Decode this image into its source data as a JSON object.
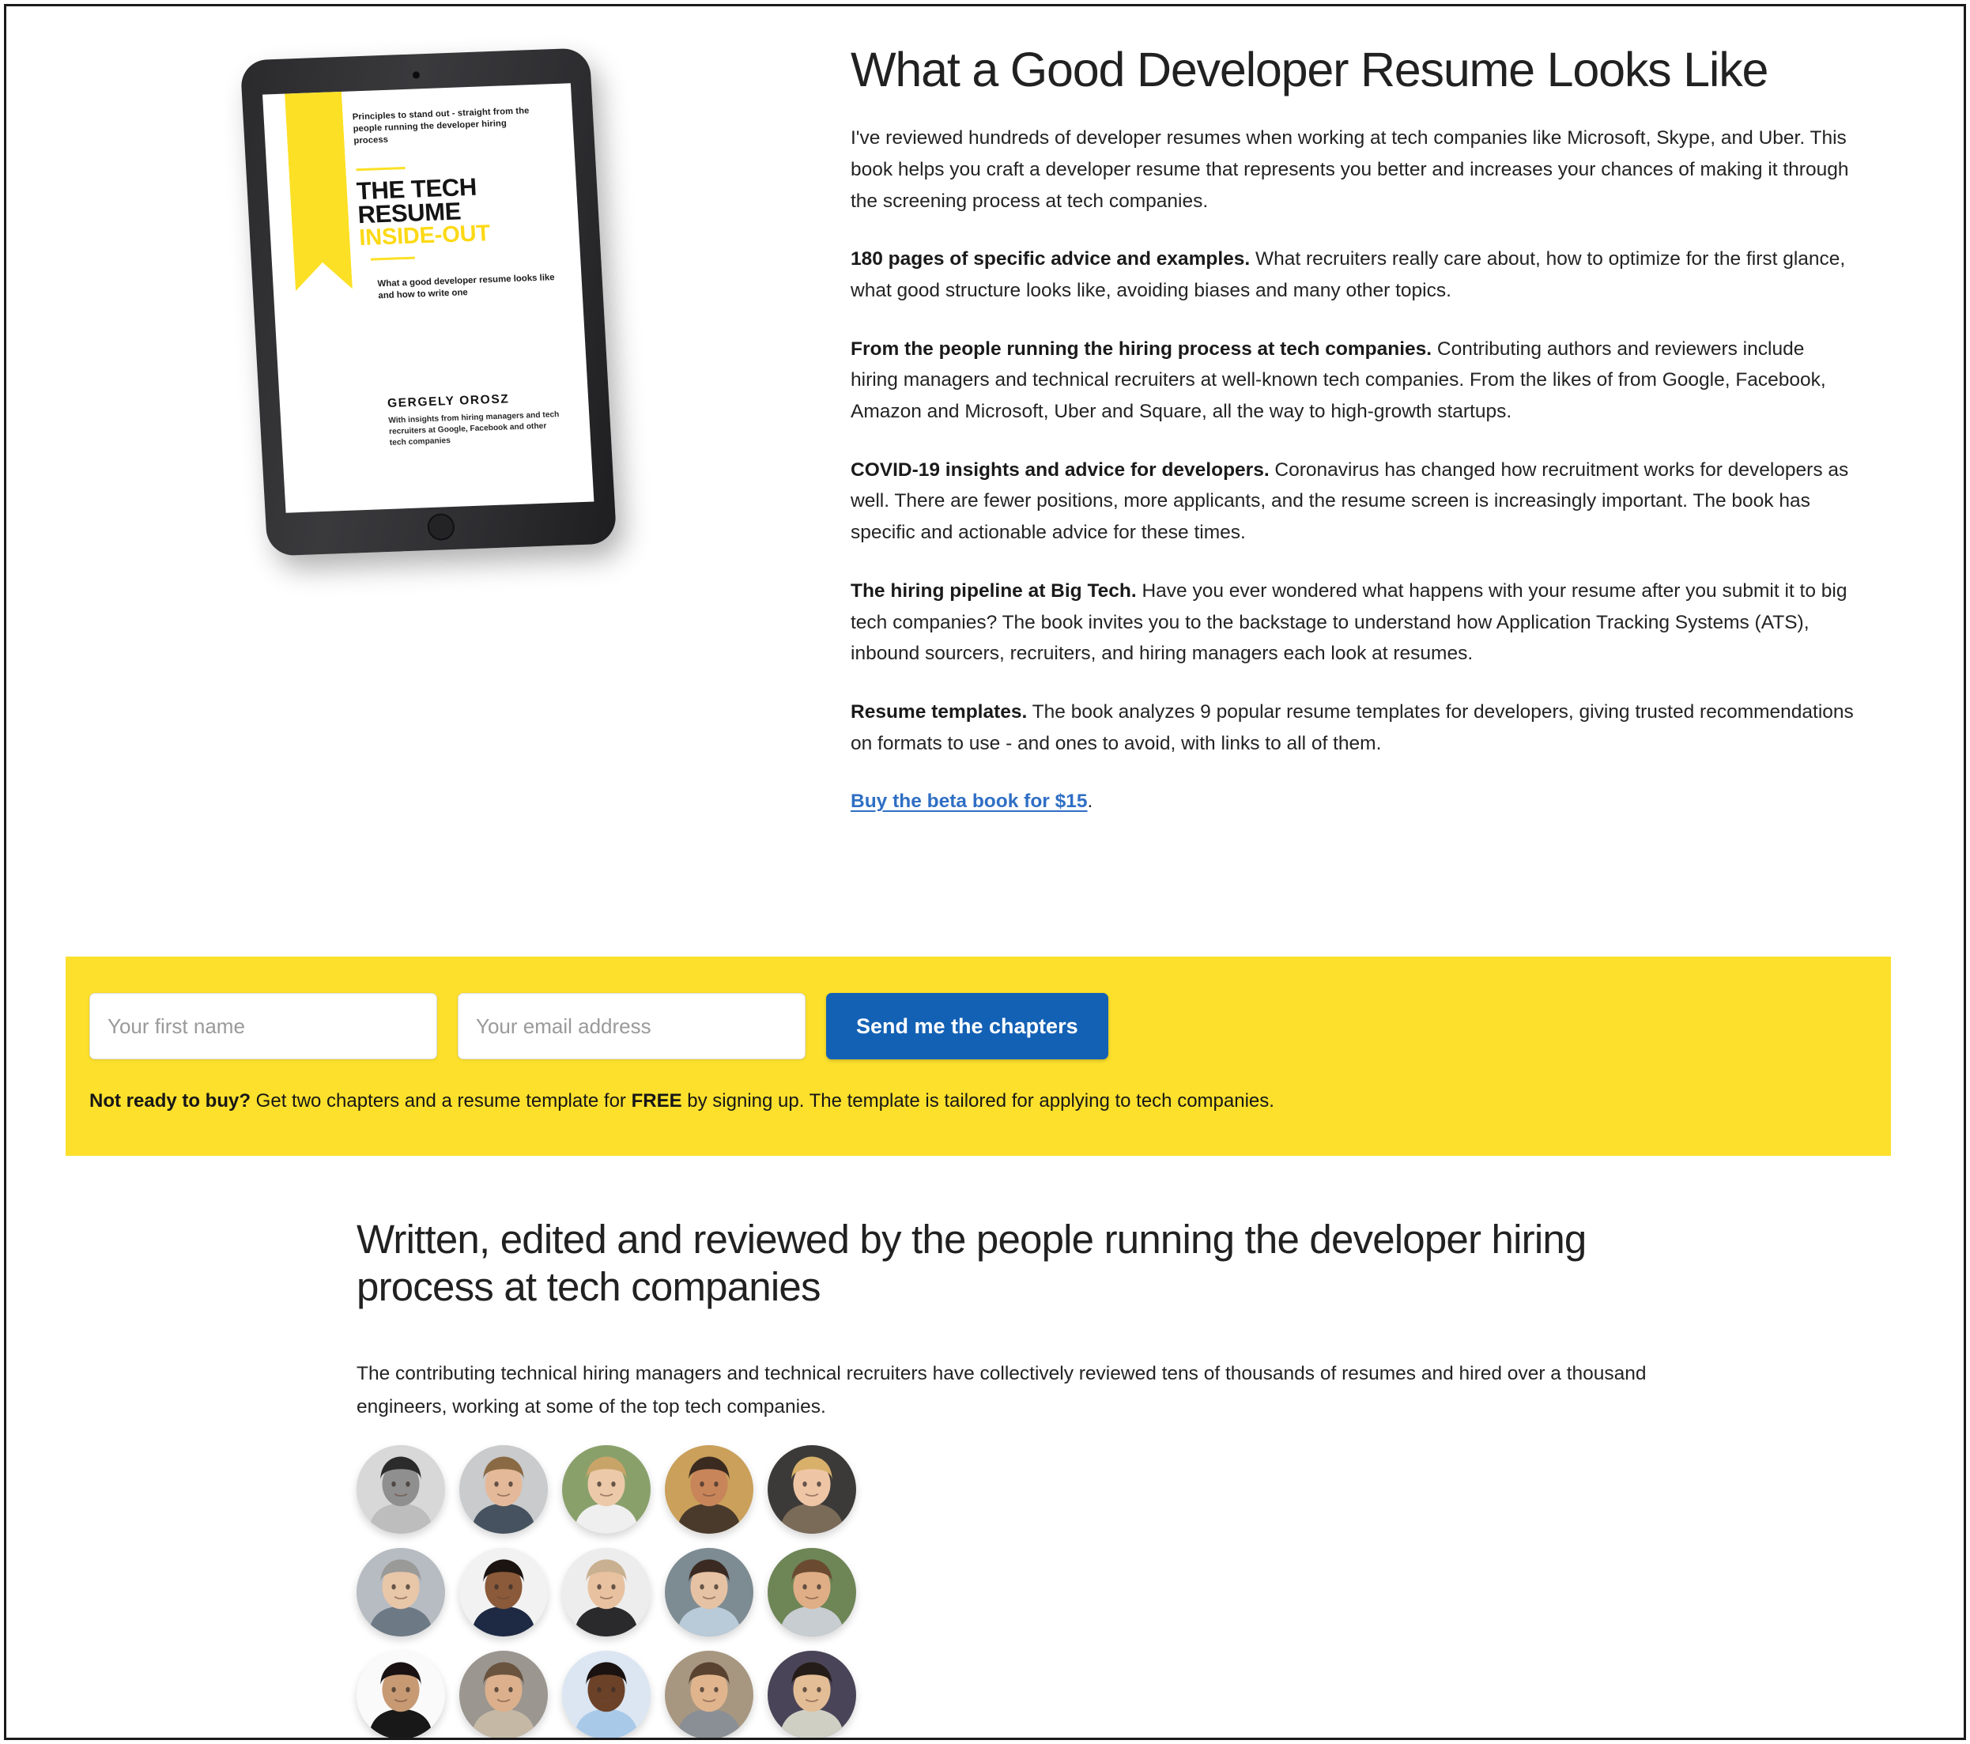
{
  "colors": {
    "accent_yellow": "#FCE02C",
    "button_blue": "#1361B5",
    "link_blue": "#2f6fc4",
    "text": "#232323"
  },
  "hero": {
    "title": "What a Good Developer Resume Looks Like",
    "paragraphs": [
      {
        "lead": "",
        "text": "I've reviewed hundreds of developer resumes when working at tech companies like Microsoft, Skype, and Uber. This book helps you craft a developer resume that represents you better and increases your chances of making it through the screening process at tech companies."
      },
      {
        "lead": "180 pages of specific advice and examples.",
        "text": " What recruiters really care about, how to optimize for the first glance, what good structure looks like, avoiding biases and many other topics."
      },
      {
        "lead": "From the people running the hiring process at tech companies.",
        "text": " Contributing authors and reviewers include hiring managers and technical recruiters at well-known tech companies. From the likes of from Google, Facebook, Amazon and Microsoft, Uber and Square, all the way to high-growth startups."
      },
      {
        "lead": "COVID-19 insights and advice for developers.",
        "text": " Coronavirus has changed how recruitment works for developers as well. There are fewer positions, more applicants, and the resume screen is increasingly important. The book has specific and actionable advice for these times."
      },
      {
        "lead": "The hiring pipeline at Big Tech.",
        "text": " Have you ever wondered what happens with your resume after you submit it to big tech companies? The book invites you to the backstage to understand how Application Tracking Systems (ATS), inbound sourcers, recruiters, and hiring managers each look at resumes."
      },
      {
        "lead": "Resume templates.",
        "text": " The book analyzes 9 popular resume templates for developers, giving trusted recommendations on formats to use - and ones to avoid, with links to all of them."
      }
    ],
    "buy_link_text": "Buy the beta book for $15",
    "buy_link_suffix": "."
  },
  "book_cover": {
    "kicker": "Principles to stand out - straight from the people running the developer hiring process",
    "title_line1": "THE TECH",
    "title_line2": "RESUME",
    "title_line3": "INSIDE-OUT",
    "subtitle": "What a good developer resume looks like and how to write one",
    "author": "GERGELY OROSZ",
    "credit": "With insights from hiring managers and tech recruiters at Google, Facebook and other tech companies"
  },
  "signup": {
    "first_name_placeholder": "Your first name",
    "first_name_value": "",
    "email_placeholder": "Your email address",
    "email_value": "",
    "submit_label": "Send me the chapters",
    "note_lead": "Not ready to buy?",
    "note_part1": " Get two chapters and a resume template for ",
    "note_free": "FREE",
    "note_part2": " by signing up. The template is tailored for applying to tech companies."
  },
  "contributors": {
    "title": "Written, edited and reviewed by the people running the developer hiring process at tech companies",
    "body": "The contributing technical hiring managers and technical recruiters have collectively reviewed tens of thousands of resumes and hired over a thousand engineers, working at some of the top tech companies.",
    "avatar_count": 15,
    "avatars": [
      {
        "name": "contributor-1",
        "bg": "#d8d8d8",
        "skin": "#8f8f8f",
        "hair": "#2b2b2b",
        "shirt": "#bdbdbd"
      },
      {
        "name": "contributor-2",
        "bg": "#c9cbcd",
        "skin": "#e4b99a",
        "hair": "#8a6a44",
        "shirt": "#46525f"
      },
      {
        "name": "contributor-3",
        "bg": "#8aa06a",
        "skin": "#eccaa9",
        "hair": "#c9a469",
        "shirt": "#efefef"
      },
      {
        "name": "contributor-4",
        "bg": "#caa05a",
        "skin": "#c8855a",
        "hair": "#3a2a20",
        "shirt": "#4a3a2c"
      },
      {
        "name": "contributor-5",
        "bg": "#3c3a38",
        "skin": "#eec6a6",
        "hair": "#d8b06a",
        "shirt": "#7a6a58"
      },
      {
        "name": "contributor-6",
        "bg": "#b7bcc2",
        "skin": "#e8c6a8",
        "hair": "#9a9a98",
        "shirt": "#6d7a86"
      },
      {
        "name": "contributor-7",
        "bg": "#f2f2f2",
        "skin": "#8a5a3a",
        "hair": "#1c1410",
        "shirt": "#1e2a44"
      },
      {
        "name": "contributor-8",
        "bg": "#ededed",
        "skin": "#e8c2a0",
        "hair": "#c9b091",
        "shirt": "#2a2a2c"
      },
      {
        "name": "contributor-9",
        "bg": "#7d8b92",
        "skin": "#e6c2a4",
        "hair": "#3a2a22",
        "shirt": "#b9cad8"
      },
      {
        "name": "contributor-10",
        "bg": "#6e8556",
        "skin": "#dfae86",
        "hair": "#6a4a30",
        "shirt": "#c8cdd2"
      },
      {
        "name": "contributor-11",
        "bg": "#fafafa",
        "skin": "#c79a74",
        "hair": "#1a1212",
        "shirt": "#181818"
      },
      {
        "name": "contributor-12",
        "bg": "#9b9690",
        "skin": "#dcb08c",
        "hair": "#6a5440",
        "shirt": "#c5b9a6"
      },
      {
        "name": "contributor-13",
        "bg": "#dbe6f2",
        "skin": "#6b4228",
        "hair": "#1a1210",
        "shirt": "#a9c9e8"
      },
      {
        "name": "contributor-14",
        "bg": "#a89780",
        "skin": "#e0b58e",
        "hair": "#5a4230",
        "shirt": "#8a8f96"
      },
      {
        "name": "contributor-15",
        "bg": "#4a4458",
        "skin": "#e3bd95",
        "hair": "#241c18",
        "shirt": "#cfcfc4"
      }
    ]
  }
}
